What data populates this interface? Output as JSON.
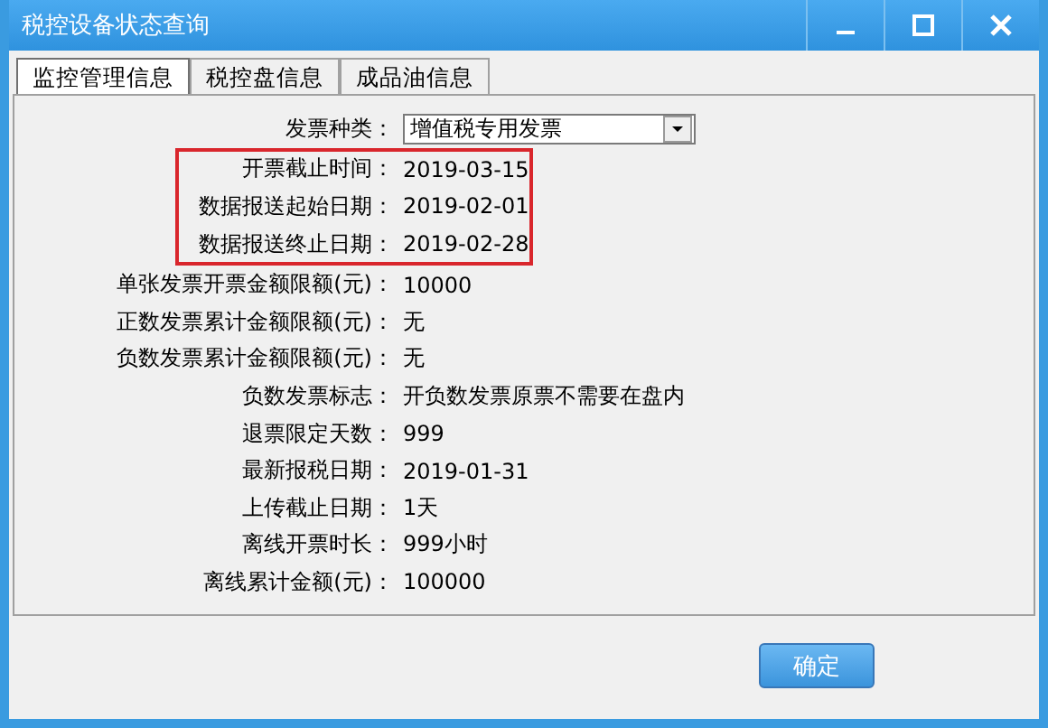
{
  "window": {
    "title": "税控设备状态查询"
  },
  "tabs": [
    {
      "label": "监控管理信息",
      "selected": true
    },
    {
      "label": "税控盘信息",
      "selected": false
    },
    {
      "label": "成品油信息",
      "selected": false
    }
  ],
  "rows": [
    {
      "kind": "select",
      "label": "发票种类：",
      "value": "增值税专用发票",
      "highlighted": false
    },
    {
      "kind": "text",
      "label": "开票截止时间：",
      "value": "2019-03-15",
      "highlighted": true
    },
    {
      "kind": "text",
      "label": "数据报送起始日期：",
      "value": "2019-02-01",
      "highlighted": true
    },
    {
      "kind": "text",
      "label": "数据报送终止日期：",
      "value": "2019-02-28",
      "highlighted": true
    },
    {
      "kind": "text",
      "label": "单张发票开票金额限额(元)：",
      "value": "10000",
      "highlighted": false
    },
    {
      "kind": "text",
      "label": "正数发票累计金额限额(元)：",
      "value": "无",
      "highlighted": false
    },
    {
      "kind": "text",
      "label": "负数发票累计金额限额(元)：",
      "value": "无",
      "highlighted": false
    },
    {
      "kind": "text",
      "label": "负数发票标志：",
      "value": "开负数发票原票不需要在盘内",
      "highlighted": false
    },
    {
      "kind": "text",
      "label": "退票限定天数：",
      "value": "999",
      "highlighted": false
    },
    {
      "kind": "text",
      "label": "最新报税日期：",
      "value": "2019-01-31",
      "highlighted": false
    },
    {
      "kind": "text",
      "label": "上传截止日期：",
      "value": "1天",
      "highlighted": false
    },
    {
      "kind": "text",
      "label": "离线开票时长：",
      "value": "999小时",
      "highlighted": false
    },
    {
      "kind": "text",
      "label": "离线累计金额(元)：",
      "value": "100000",
      "highlighted": false
    }
  ],
  "buttons": [
    "确定"
  ]
}
